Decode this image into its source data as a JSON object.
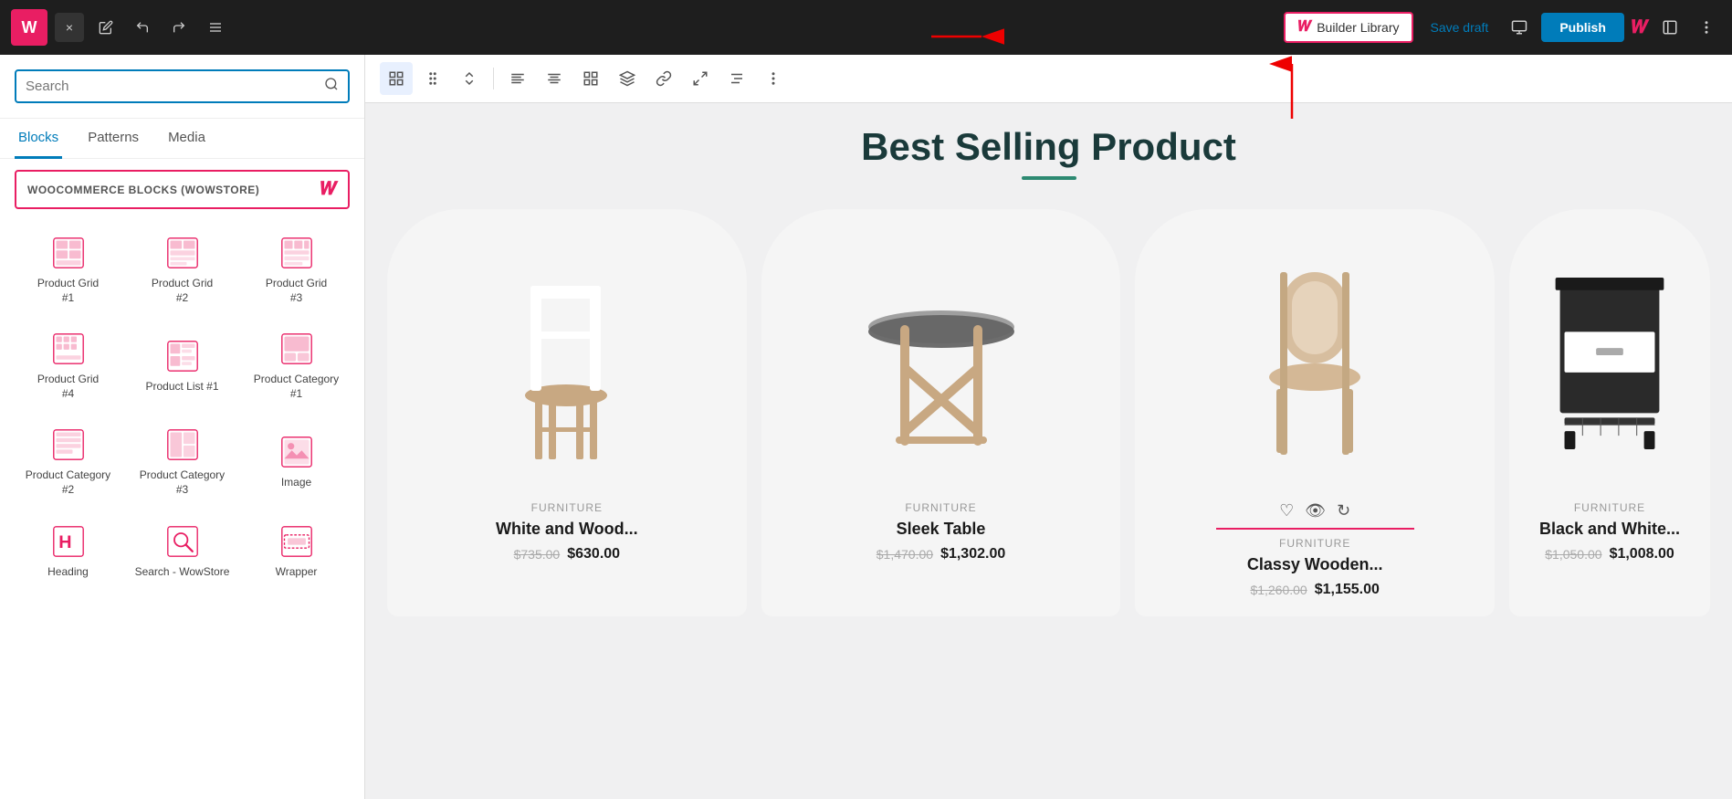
{
  "topbar": {
    "logo_text": "W",
    "close_label": "×",
    "undo_icon": "↩",
    "redo_icon": "↪",
    "hamburger_icon": "☰",
    "builder_library_label": "Builder Library",
    "save_draft_label": "Save draft",
    "publish_label": "Publish",
    "woo_icon": "W",
    "monitor_icon": "▭",
    "sidebar_icon": "▱",
    "dots_icon": "⋮"
  },
  "sidebar": {
    "search_placeholder": "Search",
    "tabs": [
      {
        "id": "blocks",
        "label": "Blocks",
        "active": true
      },
      {
        "id": "patterns",
        "label": "Patterns",
        "active": false
      },
      {
        "id": "media",
        "label": "Media",
        "active": false
      }
    ],
    "woo_blocks_header": "WOOCOMMERCE BLOCKS (WOWSTORE)",
    "blocks": [
      {
        "id": "product-grid-1",
        "label": "Product Grid\n#1"
      },
      {
        "id": "product-grid-2",
        "label": "Product Grid\n#2"
      },
      {
        "id": "product-grid-3",
        "label": "Product Grid\n#3"
      },
      {
        "id": "product-grid-4",
        "label": "Product Grid\n#4"
      },
      {
        "id": "product-list-1",
        "label": "Product List #1"
      },
      {
        "id": "product-category-1",
        "label": "Product Category #1"
      },
      {
        "id": "product-category-2",
        "label": "Product Category #2"
      },
      {
        "id": "product-category-3",
        "label": "Product Category #3"
      },
      {
        "id": "image",
        "label": "Image"
      },
      {
        "id": "heading",
        "label": "Heading"
      },
      {
        "id": "search-wowstore",
        "label": "Search - WowStore"
      },
      {
        "id": "wrapper",
        "label": "Wrapper"
      }
    ]
  },
  "toolbar": {
    "icons": [
      "⊞",
      "⠿",
      "⌃",
      "≡",
      "≡",
      "⊞",
      "⊡",
      "∞",
      "↔",
      "⚙",
      "⋮"
    ]
  },
  "content": {
    "section_title": "Best Selling Product",
    "products": [
      {
        "id": "p1",
        "category": "FURNITURE",
        "name": "White and Wood...",
        "price_original": "$735.00",
        "price_sale": "$630.00",
        "emoji": "🪑",
        "has_actions": false
      },
      {
        "id": "p2",
        "category": "FURNITURE",
        "name": "Sleek Table",
        "price_original": "$1,470.00",
        "price_sale": "$1,302.00",
        "emoji": "🪑",
        "has_actions": false
      },
      {
        "id": "p3",
        "category": "FURNITURE",
        "name": "Classy Wooden...",
        "price_original": "$1,260.00",
        "price_sale": "$1,155.00",
        "emoji": "🪑",
        "has_actions": true
      },
      {
        "id": "p4",
        "category": "FURNITURE",
        "name": "Black and White...",
        "price_original": "$1,050.00",
        "price_sale": "$1,008.00",
        "emoji": "🗄",
        "has_actions": false
      }
    ]
  }
}
